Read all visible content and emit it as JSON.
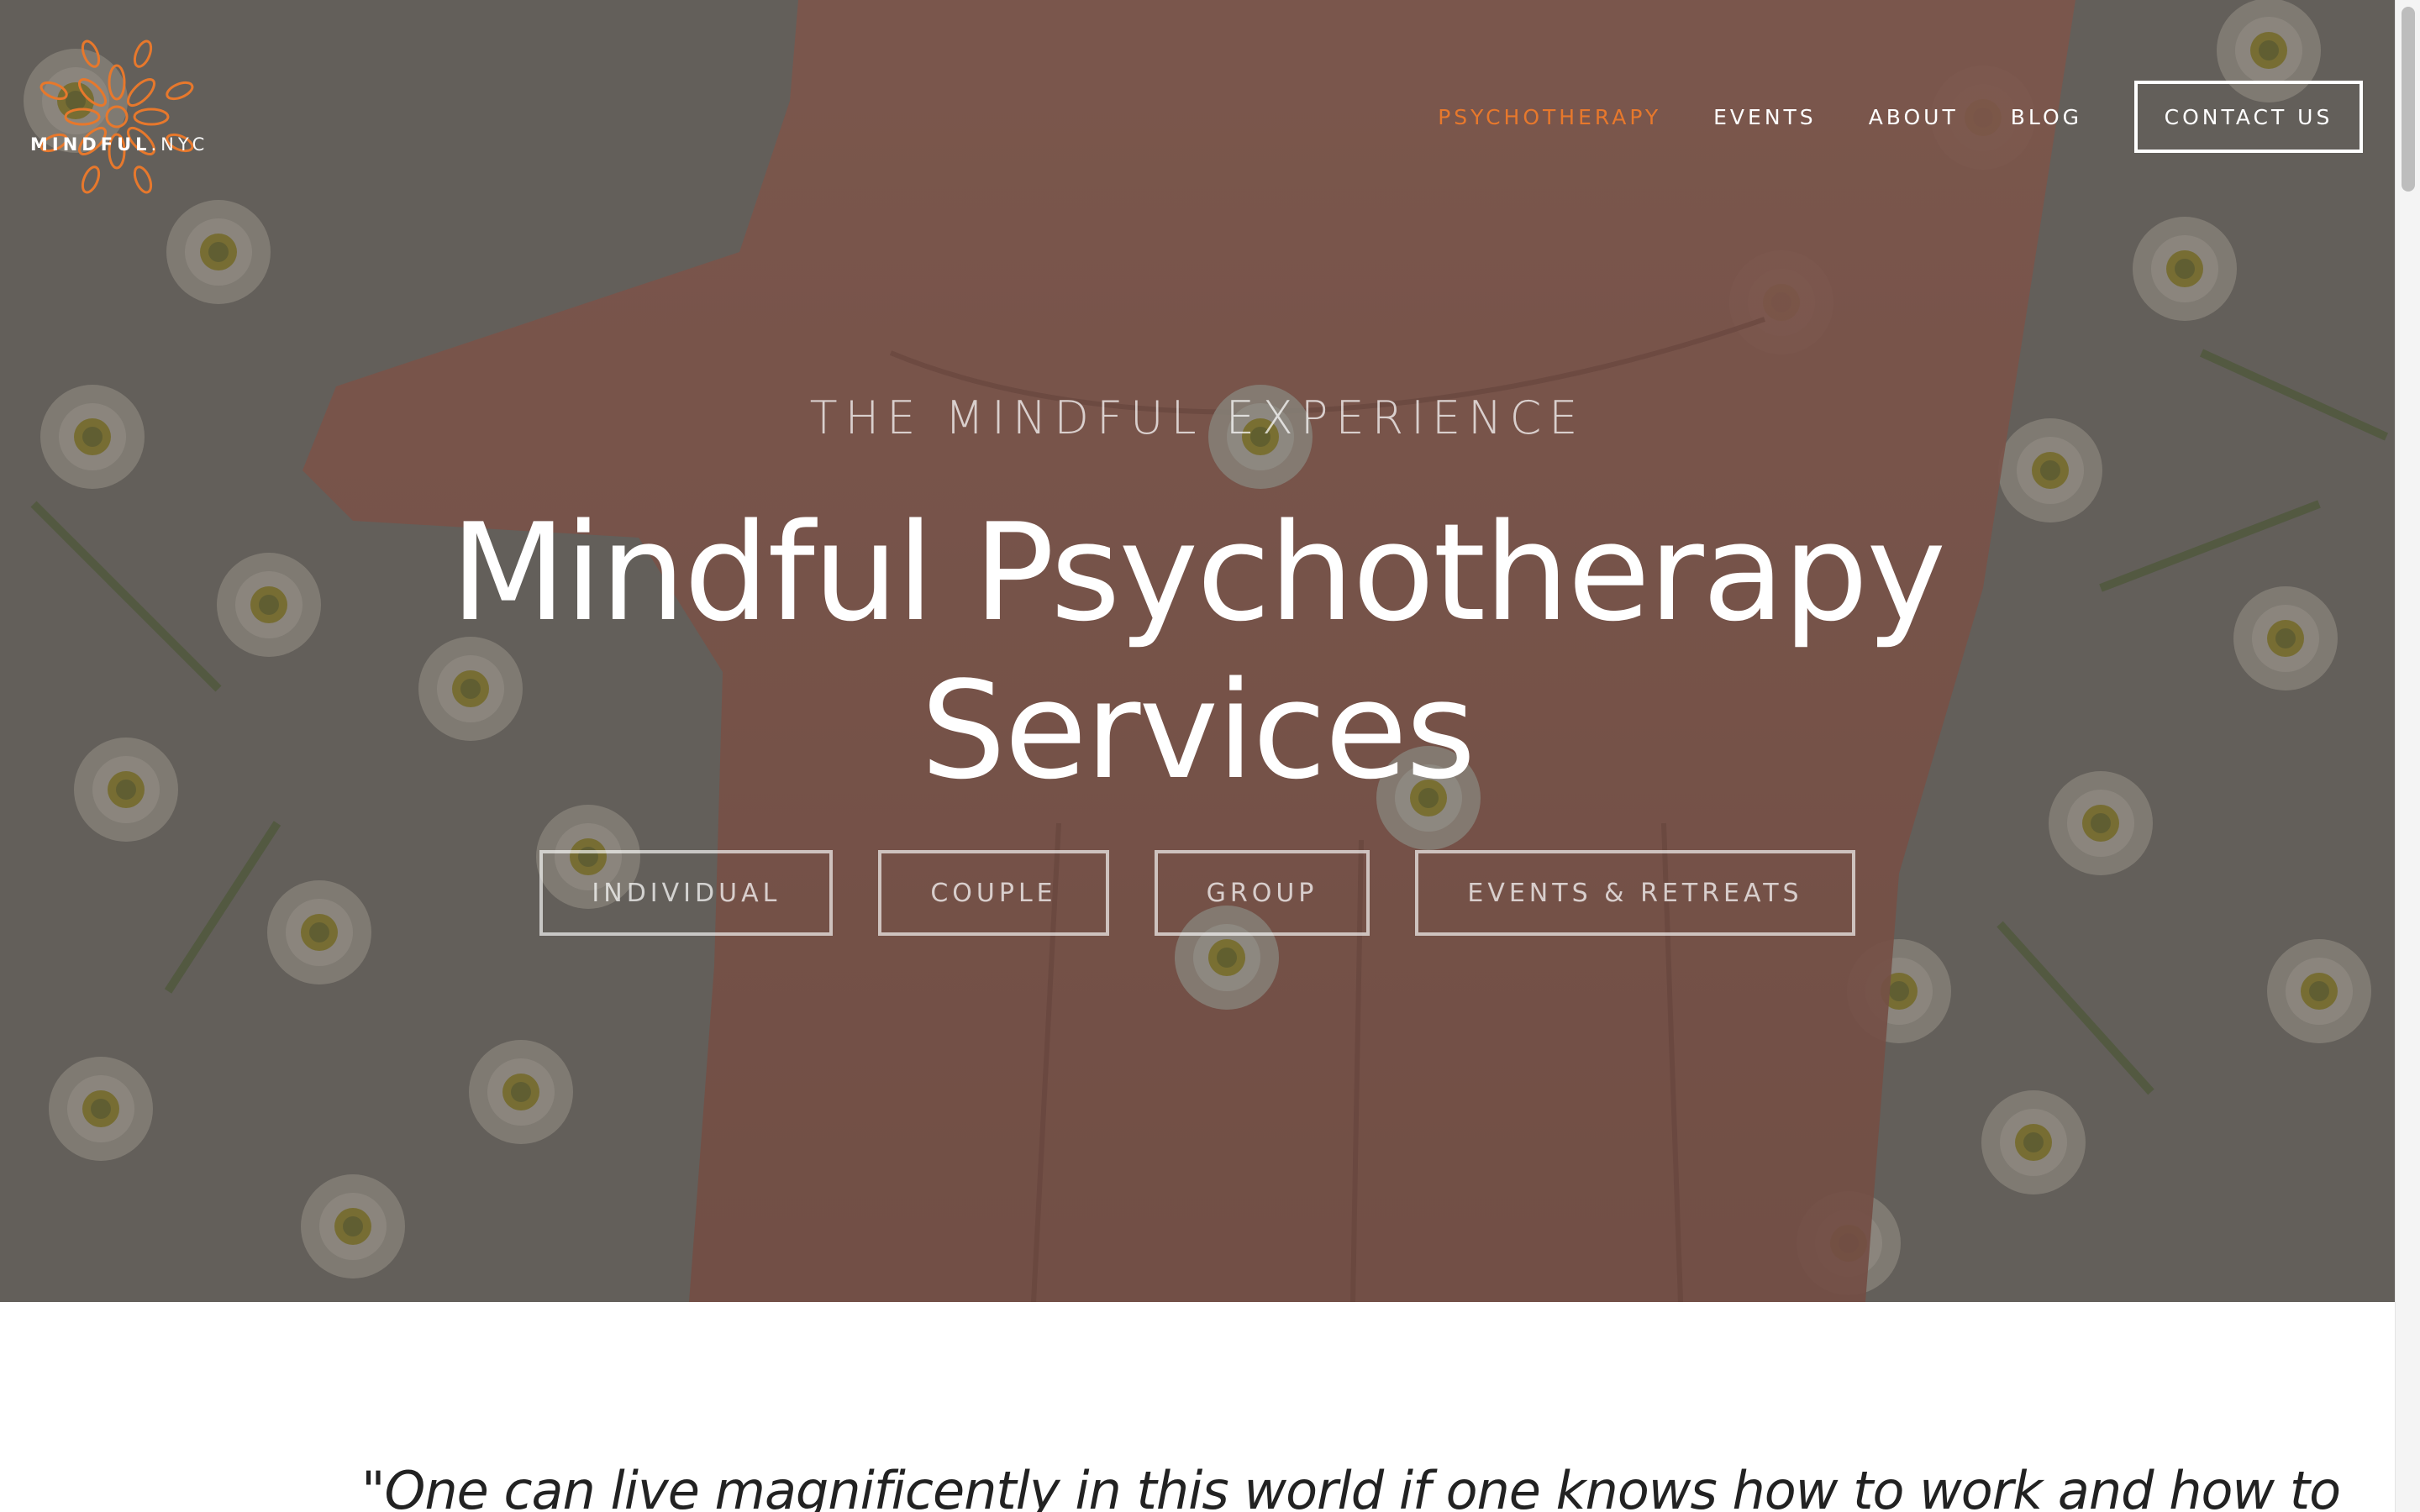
{
  "brand": {
    "name_strong": "MINDFUL",
    "name_light": ".NYC",
    "accent_color": "#e7782c"
  },
  "nav": {
    "items": [
      {
        "label": "PSYCHOTHERAPY",
        "active": true
      },
      {
        "label": "EVENTS",
        "active": false
      },
      {
        "label": "ABOUT",
        "active": false
      },
      {
        "label": "BLOG",
        "active": false
      }
    ],
    "contact_label": "CONTACT US"
  },
  "hero": {
    "eyebrow": "THE MINDFUL EXPERIENCE",
    "title_line1": "Mindful Psychotherapy",
    "title_line2": "Services",
    "buttons": [
      {
        "label": "INDIVIDUAL"
      },
      {
        "label": "COUPLE"
      },
      {
        "label": "GROUP"
      },
      {
        "label": "EVENTS & RETREATS"
      }
    ]
  },
  "quote": {
    "text": "\"One can live magnificently in this world if one knows how to work and how to"
  }
}
